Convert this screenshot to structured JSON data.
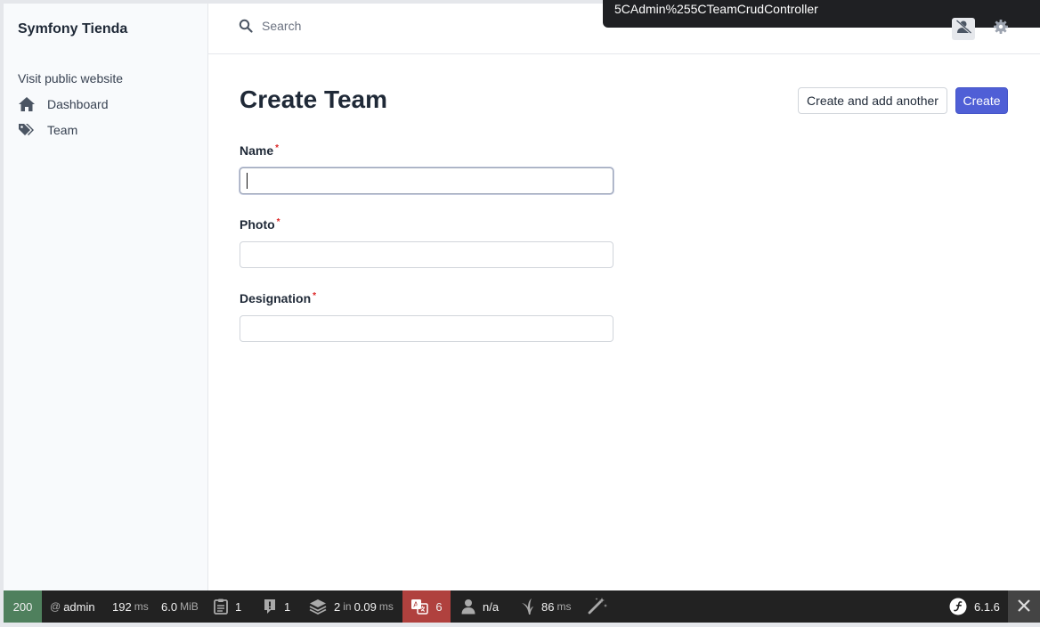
{
  "sidebar": {
    "brand": "Symfony Tienda",
    "visit_link": "Visit public website",
    "items": [
      {
        "label": "Dashboard",
        "icon": "home-icon"
      },
      {
        "label": "Team",
        "icon": "tags-icon"
      }
    ]
  },
  "header": {
    "search_placeholder": "Search",
    "tooltip_text": "5CAdmin%255CTeamCrudController"
  },
  "main": {
    "title": "Create Team",
    "buttons": {
      "create_and_add": "Create and add another",
      "create": "Create"
    },
    "fields": [
      {
        "label": "Name",
        "required": "*",
        "value": ""
      },
      {
        "label": "Photo",
        "required": "*",
        "value": ""
      },
      {
        "label": "Designation",
        "required": "*",
        "value": ""
      }
    ]
  },
  "toolbar": {
    "status_code": "200",
    "user_prefix": "@",
    "user": "admin",
    "time_value": "192",
    "time_unit": "ms",
    "memory_value": "6.0",
    "memory_unit": "MiB",
    "logs_count": "1",
    "exceptions_count": "1",
    "cache_calls": "2",
    "cache_in": "in",
    "cache_time": "0.09",
    "cache_unit": "ms",
    "translation_count": "6",
    "security": "n/a",
    "twig_time": "86",
    "twig_unit": "ms",
    "symfony_version": "6.1.6"
  },
  "colors": {
    "primary_button": "#4f5fd6",
    "status_ok": "#4f805d",
    "translation_error": "#b0413e",
    "toolbar_bg": "#222222"
  }
}
